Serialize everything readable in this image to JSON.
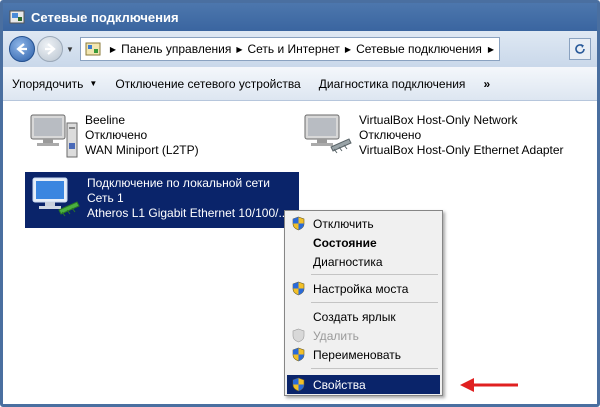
{
  "window": {
    "title": "Сетевые подключения"
  },
  "address": {
    "crumbs": [
      "Панель управления",
      "Сеть и Интернет",
      "Сетевые подключения"
    ]
  },
  "toolbar": {
    "organize": "Упорядочить",
    "disable": "Отключение сетевого устройства",
    "diagnose": "Диагностика подключения",
    "more": "»"
  },
  "connections": [
    {
      "name": "Beeline",
      "status": "Отключено",
      "device": "WAN Miniport (L2TP)"
    },
    {
      "name": "VirtualBox Host-Only Network",
      "status": "Отключено",
      "device": "VirtualBox Host-Only Ethernet Adapter"
    },
    {
      "name": "Подключение по локальной сети",
      "status": "Сеть  1",
      "device": "Atheros L1 Gigabit Ethernet 10/100/..."
    }
  ],
  "context_menu": {
    "items": [
      {
        "label": "Отключить"
      },
      {
        "label": "Состояние"
      },
      {
        "label": "Диагностика"
      },
      {
        "label": "Настройка моста"
      },
      {
        "label": "Создать ярлык"
      },
      {
        "label": "Удалить"
      },
      {
        "label": "Переименовать"
      },
      {
        "label": "Свойства"
      }
    ]
  },
  "colors": {
    "selection": "#0a246a",
    "titlebar": "#3a65a0",
    "annotation_arrow": "#e02020"
  }
}
